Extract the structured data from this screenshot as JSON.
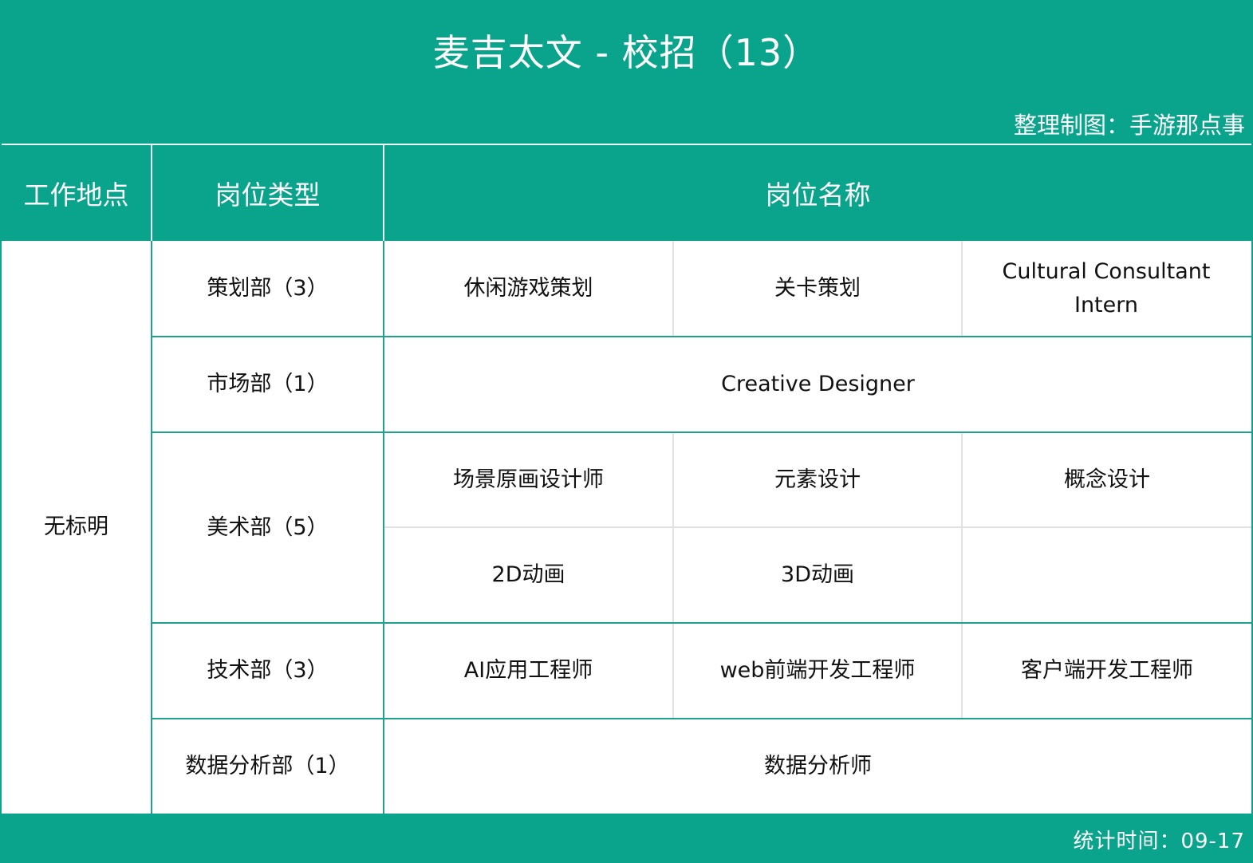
{
  "title": "麦吉太文 - 校招（13）",
  "credit": "整理制图：手游那点事",
  "headers": {
    "location": "工作地点",
    "category": "岗位类型",
    "positions": "岗位名称"
  },
  "location": "无标明",
  "departments": [
    {
      "name": "策划部（3）",
      "positions": [
        "休闲游戏策划",
        "关卡策划",
        "Cultural Consultant Intern"
      ]
    },
    {
      "name": "市场部（1）",
      "positions": [
        "Creative Designer"
      ]
    },
    {
      "name": "美术部（5）",
      "positions": [
        "场景原画设计师",
        "元素设计",
        "概念设计",
        "2D动画",
        "3D动画"
      ]
    },
    {
      "name": "技术部（3）",
      "positions": [
        "AI应用工程师",
        "web前端开发工程师",
        "客户端开发工程师"
      ]
    },
    {
      "name": "数据分析部（1）",
      "positions": [
        "数据分析师"
      ]
    }
  ],
  "footer": "统计时间：09-17",
  "colors": {
    "brand": "#0aa38b",
    "border": "#1fa28d",
    "inner_grid": "#e2e2e2"
  }
}
